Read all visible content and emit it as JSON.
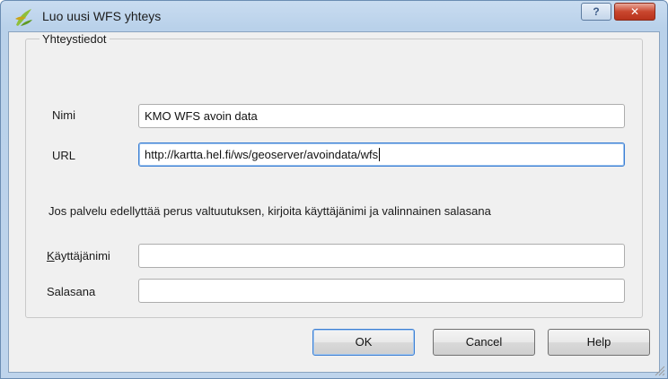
{
  "window": {
    "title": "Luo uusi WFS yhteys",
    "help_button": "?",
    "close_button": "✕"
  },
  "group": {
    "legend": "Yhteystiedot"
  },
  "form": {
    "name_label": "Nimi",
    "name_value": "KMO WFS avoin data",
    "url_label": "URL",
    "url_value": "http://kartta.hel.fi/ws/geoserver/avoindata/wfs",
    "auth_info": "Jos palvelu edellyttää perus valtuutuksen, kirjoita käyttäjänimi ja valinnainen salasana",
    "username_label_first": "K",
    "username_label_rest": "äyttäjänimi",
    "username_value": "",
    "password_label": "Salasana",
    "password_value": ""
  },
  "buttons": {
    "ok": "OK",
    "cancel": "Cancel",
    "help": "Help"
  },
  "colors": {
    "titlebar": "#b9d1ea",
    "focus_border": "#3c7fd3",
    "close_red": "#c9462e"
  },
  "icons": {
    "app": "qgis-icon",
    "resize": "resize-grip-icon"
  }
}
